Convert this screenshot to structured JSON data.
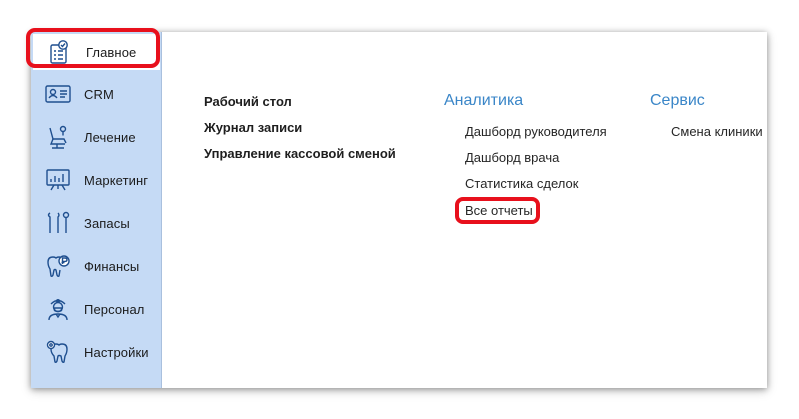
{
  "sidebar": {
    "items": [
      {
        "label": "Главное",
        "icon": "home-checklist-icon"
      },
      {
        "label": "CRM",
        "icon": "id-card-icon"
      },
      {
        "label": "Лечение",
        "icon": "dental-chair-icon"
      },
      {
        "label": "Маркетинг",
        "icon": "chart-board-icon"
      },
      {
        "label": "Запасы",
        "icon": "dental-tools-icon"
      },
      {
        "label": "Финансы",
        "icon": "tooth-coin-icon"
      },
      {
        "label": "Персонал",
        "icon": "doctor-icon"
      },
      {
        "label": "Настройки",
        "icon": "tooth-gear-icon"
      }
    ]
  },
  "main": {
    "quick_links": [
      "Рабочий стол",
      "Журнал записи",
      "Управление кассовой сменой"
    ],
    "analytics": {
      "title": "Аналитика",
      "items": [
        "Дашборд руководителя",
        "Дашборд врача",
        "Статистика сделок",
        "Все отчеты"
      ]
    },
    "service": {
      "title": "Сервис",
      "items": [
        "Смена клиники"
      ]
    }
  },
  "colors": {
    "sidebar_bg": "#c5daf5",
    "heading": "#3a86c8",
    "highlight": "#e8101c",
    "icon": "#1f4f8f"
  }
}
